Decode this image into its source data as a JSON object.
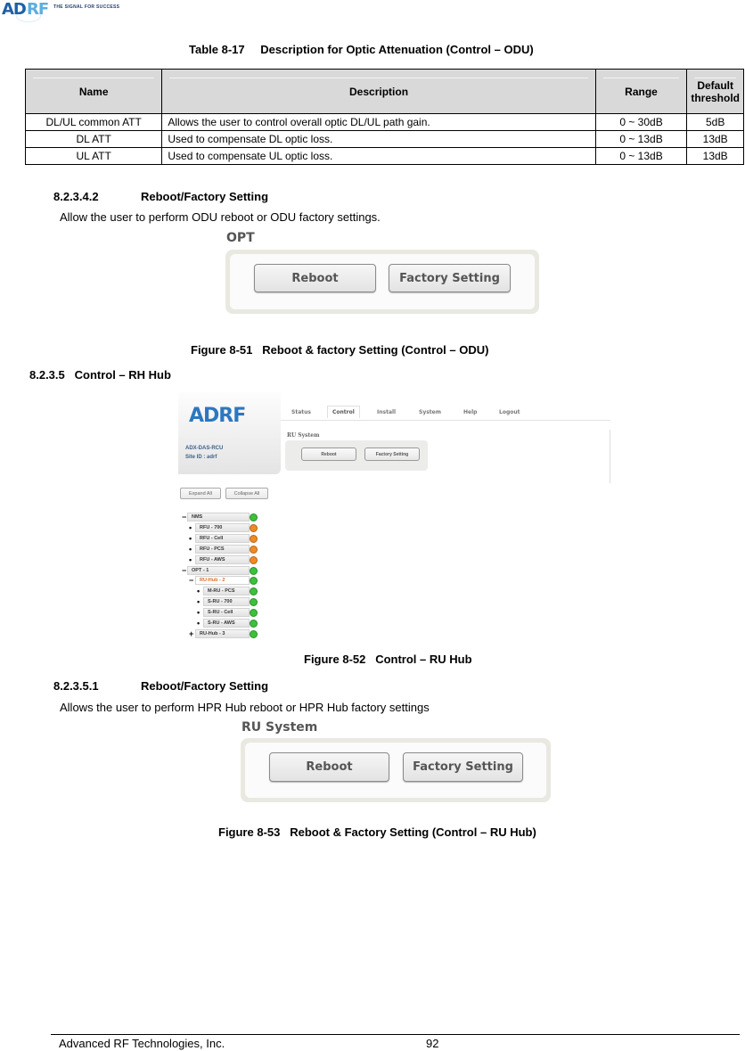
{
  "header": {
    "logo_ad": "AD",
    "logo_rf": "RF",
    "tagline": "THE SIGNAL FOR SUCCESS"
  },
  "table": {
    "caption_num": "Table 8-17",
    "caption_text": "Description for Optic Attenuation (Control – ODU)",
    "columns": [
      "Name",
      "Description",
      "Range",
      "Default threshold"
    ],
    "rows": [
      {
        "name": "DL/UL common ATT",
        "description": "Allows the user to control overall optic DL/UL path gain.",
        "range": "0 ~ 30dB",
        "default": "5dB"
      },
      {
        "name": "DL ATT",
        "description": "Used to compensate DL optic loss.",
        "range": "0 ~ 13dB",
        "default": "13dB"
      },
      {
        "name": "UL ATT",
        "description": "Used to compensate UL optic loss.",
        "range": "0 ~ 13dB",
        "default": "13dB"
      }
    ]
  },
  "section_odu": {
    "number": "8.2.3.4.2",
    "title": "Reboot/Factory Setting",
    "text": "Allow the user to perform ODU reboot or ODU factory settings."
  },
  "figure_51": {
    "panel_title": "OPT",
    "reboot_label": "Reboot",
    "factory_label": "Factory Setting",
    "caption_num": "Figure 8-51",
    "caption_text": "Reboot & factory Setting (Control – ODU)"
  },
  "section_rh_hub": {
    "number": "8.2.3.5",
    "title": "Control – RH Hub"
  },
  "figure_52": {
    "logo_ad": "AD",
    "logo_rf": "RF",
    "model": "ADX-DAS-RCU",
    "site_id": "Site ID : adrf",
    "tabs": [
      "Status",
      "Control",
      "Install",
      "System",
      "Help",
      "Logout"
    ],
    "active_tab": "Control",
    "panel_title": "RU System",
    "reboot_label": "Reboot",
    "factory_label": "Factory Setting",
    "expand_all": "Expand All",
    "collapse_all": "Collapse All",
    "tree": [
      {
        "symbol": "−",
        "label": "NMS",
        "status": "green",
        "level": 0
      },
      {
        "symbol": "•",
        "label": "RFU - 700",
        "status": "orange",
        "level": 1
      },
      {
        "symbol": "•",
        "label": "RFU - Cell",
        "status": "orange",
        "level": 1
      },
      {
        "symbol": "•",
        "label": "RFU - PCS",
        "status": "orange",
        "level": 1
      },
      {
        "symbol": "•",
        "label": "RFU - AWS",
        "status": "orange",
        "level": 1
      },
      {
        "symbol": "−",
        "label": "OPT - 1",
        "status": "green",
        "level": 0
      },
      {
        "symbol": "−",
        "label": "RU-Hub - 2",
        "status": "green",
        "level": 1,
        "highlight": true
      },
      {
        "symbol": "•",
        "label": "M-RU - PCS",
        "status": "green",
        "level": 2
      },
      {
        "symbol": "•",
        "label": "S-RU - 700",
        "status": "green",
        "level": 2
      },
      {
        "symbol": "•",
        "label": "S-RU - Cell",
        "status": "green",
        "level": 2
      },
      {
        "symbol": "•",
        "label": "S-RU - AWS",
        "status": "green",
        "level": 2
      },
      {
        "symbol": "+",
        "label": "RU-Hub - 3",
        "status": "green",
        "level": 1
      }
    ],
    "status_colors": {
      "green": "#3cc13b",
      "orange": "#f08a24"
    },
    "caption_num": "Figure 8-52",
    "caption_text": "Control – RU Hub"
  },
  "section_ru_hub": {
    "number": "8.2.3.5.1",
    "title": "Reboot/Factory Setting",
    "text": "Allows the user to perform HPR Hub reboot or HPR Hub factory settings"
  },
  "figure_53": {
    "panel_title": "RU System",
    "reboot_label": "Reboot",
    "factory_label": "Factory Setting",
    "caption_num": "Figure 8-53",
    "caption_text": "Reboot & Factory Setting (Control – RU Hub)"
  },
  "footer": {
    "company": "Advanced RF Technologies, Inc.",
    "page_number": "92"
  }
}
